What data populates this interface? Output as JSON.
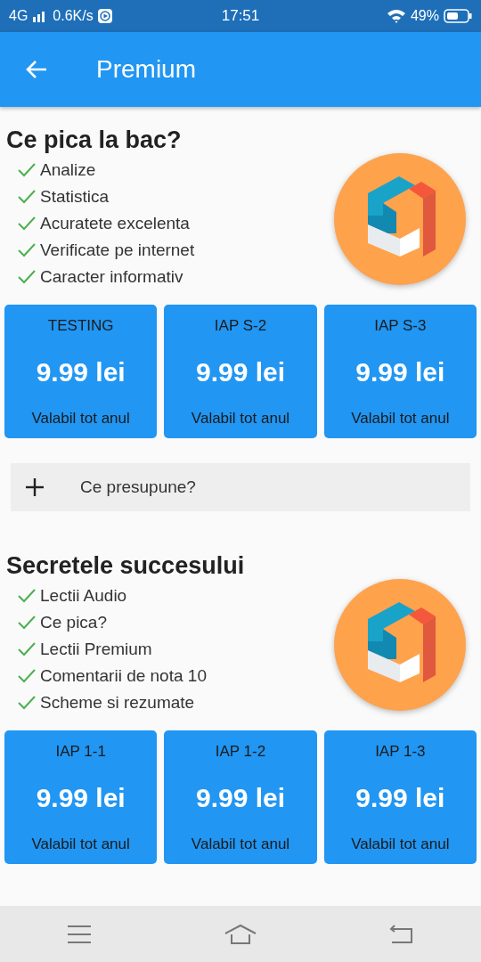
{
  "status_bar": {
    "network": "4G",
    "speed": "0.6K/s",
    "time": "17:51",
    "battery": "49%"
  },
  "app_bar": {
    "title": "Premium"
  },
  "sections": [
    {
      "title": "Ce pica la bac?",
      "features": [
        "Analize",
        "Statistica",
        "Acuratete excelenta",
        "Verificate pe internet",
        "Caracter informativ"
      ],
      "plans": [
        {
          "name": "TESTING",
          "price": "9.99 lei",
          "period": "Valabil tot anul"
        },
        {
          "name": "IAP S-2",
          "price": "9.99 lei",
          "period": "Valabil tot anul"
        },
        {
          "name": "IAP S-3",
          "price": "9.99 lei",
          "period": "Valabil tot anul"
        }
      ],
      "expander": {
        "label": "Ce presupune?",
        "expanded": false
      }
    },
    {
      "title": "Secretele succesului",
      "features": [
        "Lectii Audio",
        "Ce pica?",
        "Lectii Premium",
        "Comentarii de nota 10",
        "Scheme si rezumate"
      ],
      "plans": [
        {
          "name": "IAP 1-1",
          "price": "9.99 lei",
          "period": "Valabil tot anul"
        },
        {
          "name": "IAP 1-2",
          "price": "9.99 lei",
          "period": "Valabil tot anul"
        },
        {
          "name": "IAP 1-3",
          "price": "9.99 lei",
          "period": "Valabil tot anul"
        }
      ]
    }
  ]
}
